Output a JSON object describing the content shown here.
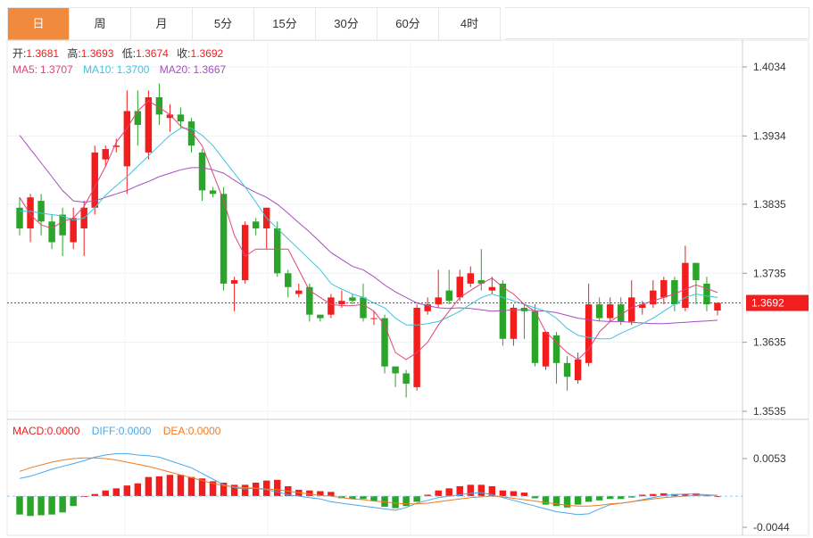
{
  "tabs": [
    {
      "label": "日",
      "active": true
    },
    {
      "label": "周",
      "active": false
    },
    {
      "label": "月",
      "active": false
    },
    {
      "label": "5分",
      "active": false
    },
    {
      "label": "15分",
      "active": false
    },
    {
      "label": "30分",
      "active": false
    },
    {
      "label": "60分",
      "active": false
    },
    {
      "label": "4时",
      "active": false
    }
  ],
  "info": {
    "open_label": "开:",
    "open_value": "1.3681",
    "high_label": "高:",
    "high_value": "1.3693",
    "low_label": "低:",
    "low_value": "1.3674",
    "close_label": "收:",
    "close_value": "1.3692",
    "ma5_label": "MA5:",
    "ma5_value": "1.3707",
    "ma10_label": "MA10:",
    "ma10_value": "1.3700",
    "ma20_label": "MA20:",
    "ma20_value": "1.3667"
  },
  "macd_info": {
    "macd_label": "MACD:",
    "macd_value": "0.0000",
    "diff_label": "DIFF:",
    "diff_value": "0.0000",
    "dea_label": "DEA:",
    "dea_value": "0.0000"
  },
  "current_price": "1.3692",
  "colors": {
    "up": "#f21d1d",
    "down": "#2aa52a",
    "ma5": "#e0457b",
    "ma10": "#3fc3e0",
    "ma20": "#a64dc0",
    "diff": "#4aa8e8",
    "dea": "#f07b23",
    "price_tag": "#f21d1d"
  },
  "chart_data": [
    {
      "type": "candlestick",
      "y_ticks": [
        "1.4034",
        "1.3934",
        "1.3835",
        "1.3735",
        "1.3635",
        "1.3535"
      ],
      "ylim": [
        1.3525,
        1.4045
      ],
      "candles": [
        [
          1.383,
          1.38,
          1.3845,
          1.379
        ],
        [
          1.38,
          1.3845,
          1.385,
          1.378
        ],
        [
          1.384,
          1.381,
          1.385,
          1.379
        ],
        [
          1.381,
          1.378,
          1.382,
          1.377
        ],
        [
          1.382,
          1.379,
          1.383,
          1.376
        ],
        [
          1.378,
          1.3815,
          1.383,
          1.377
        ],
        [
          1.38,
          1.383,
          1.384,
          1.376
        ],
        [
          1.383,
          1.391,
          1.392,
          1.382
        ],
        [
          1.39,
          1.3915,
          1.392,
          1.389
        ],
        [
          1.3918,
          1.392,
          1.393,
          1.391
        ],
        [
          1.389,
          1.397,
          1.4,
          1.385
        ],
        [
          1.397,
          1.395,
          1.4,
          1.392
        ],
        [
          1.391,
          1.399,
          1.4,
          1.39
        ],
        [
          1.399,
          1.3965,
          1.401,
          1.395
        ],
        [
          1.396,
          1.3965,
          1.398,
          1.394
        ],
        [
          1.3965,
          1.3955,
          1.3975,
          1.3945
        ],
        [
          1.3955,
          1.392,
          1.396,
          1.391
        ],
        [
          1.391,
          1.3855,
          1.3915,
          1.384
        ],
        [
          1.3855,
          1.385,
          1.386,
          1.3845
        ],
        [
          1.385,
          1.372,
          1.386,
          1.371
        ],
        [
          1.372,
          1.3725,
          1.373,
          1.368
        ],
        [
          1.3725,
          1.3805,
          1.381,
          1.372
        ],
        [
          1.381,
          1.38,
          1.3815,
          1.379
        ],
        [
          1.38,
          1.383,
          1.383,
          1.377
        ],
        [
          1.38,
          1.3735,
          1.381,
          1.373
        ],
        [
          1.3735,
          1.3715,
          1.374,
          1.37
        ],
        [
          1.3705,
          1.371,
          1.372,
          1.37
        ],
        [
          1.3715,
          1.3675,
          1.372,
          1.3665
        ],
        [
          1.3675,
          1.367,
          1.3675,
          1.3665
        ],
        [
          1.3675,
          1.37,
          1.3705,
          1.367
        ],
        [
          1.369,
          1.3695,
          1.371,
          1.3685
        ],
        [
          1.37,
          1.3695,
          1.3705,
          1.369
        ],
        [
          1.37,
          1.367,
          1.372,
          1.3665
        ],
        [
          1.367,
          1.367,
          1.368,
          1.366
        ],
        [
          1.367,
          1.36,
          1.3675,
          1.359
        ],
        [
          1.36,
          1.359,
          1.36,
          1.357
        ],
        [
          1.359,
          1.3575,
          1.3595,
          1.3555
        ],
        [
          1.357,
          1.3685,
          1.369,
          1.3565
        ],
        [
          1.368,
          1.369,
          1.37,
          1.3675
        ],
        [
          1.369,
          1.37,
          1.374,
          1.3685
        ],
        [
          1.371,
          1.3695,
          1.374,
          1.369
        ],
        [
          1.37,
          1.373,
          1.374,
          1.3695
        ],
        [
          1.372,
          1.3735,
          1.3745,
          1.3715
        ],
        [
          1.3725,
          1.372,
          1.377,
          1.371
        ],
        [
          1.371,
          1.3715,
          1.373,
          1.3705
        ],
        [
          1.372,
          1.364,
          1.3725,
          1.363
        ],
        [
          1.364,
          1.3685,
          1.369,
          1.363
        ],
        [
          1.3685,
          1.368,
          1.369,
          1.364
        ],
        [
          1.368,
          1.3605,
          1.369,
          1.36
        ],
        [
          1.36,
          1.365,
          1.365,
          1.3595
        ],
        [
          1.3645,
          1.3605,
          1.365,
          1.3575
        ],
        [
          1.3605,
          1.3585,
          1.3615,
          1.3565
        ],
        [
          1.358,
          1.361,
          1.362,
          1.3575
        ],
        [
          1.3605,
          1.369,
          1.372,
          1.36
        ],
        [
          1.369,
          1.367,
          1.37,
          1.3665
        ],
        [
          1.367,
          1.369,
          1.37,
          1.3665
        ],
        [
          1.369,
          1.3665,
          1.37,
          1.366
        ],
        [
          1.3665,
          1.37,
          1.3725,
          1.366
        ],
        [
          1.3685,
          1.369,
          1.3695,
          1.3675
        ],
        [
          1.369,
          1.371,
          1.3725,
          1.3685
        ],
        [
          1.37,
          1.3725,
          1.373,
          1.369
        ],
        [
          1.3725,
          1.369,
          1.373,
          1.368
        ],
        [
          1.3685,
          1.375,
          1.3775,
          1.368
        ],
        [
          1.375,
          1.3725,
          1.375,
          1.369
        ],
        [
          1.372,
          1.369,
          1.373,
          1.368
        ],
        [
          1.3681,
          1.3692,
          1.3693,
          1.3674
        ]
      ],
      "ma5": [
        1.3845,
        1.382,
        1.3805,
        1.38,
        1.381,
        1.3815,
        1.3832,
        1.386,
        1.389,
        1.3925,
        1.3945,
        1.397,
        1.3985,
        1.3975,
        1.3965,
        1.3948,
        1.394,
        1.392,
        1.388,
        1.384,
        1.379,
        1.376,
        1.377,
        1.377,
        1.377,
        1.377,
        1.374,
        1.371,
        1.37,
        1.369,
        1.3688,
        1.3688,
        1.369,
        1.368,
        1.366,
        1.362,
        1.361,
        1.362,
        1.3635,
        1.366,
        1.368,
        1.37,
        1.371,
        1.372,
        1.3728,
        1.3715,
        1.3705,
        1.369,
        1.368,
        1.365,
        1.3635,
        1.362,
        1.361,
        1.3625,
        1.365,
        1.3665,
        1.3675,
        1.3685,
        1.369,
        1.3695,
        1.37,
        1.3705,
        1.3712,
        1.3718,
        1.3713,
        1.3707
      ],
      "ma10": [
        1.3825,
        1.3825,
        1.3822,
        1.382,
        1.3818,
        1.3812,
        1.3815,
        1.383,
        1.3848,
        1.3862,
        1.3875,
        1.389,
        1.3905,
        1.392,
        1.3935,
        1.3945,
        1.3945,
        1.3935,
        1.392,
        1.39,
        1.388,
        1.386,
        1.3838,
        1.3815,
        1.38,
        1.3785,
        1.377,
        1.3755,
        1.374,
        1.372,
        1.3712,
        1.3705,
        1.37,
        1.3692,
        1.3685,
        1.367,
        1.366,
        1.366,
        1.3662,
        1.3665,
        1.3672,
        1.368,
        1.369,
        1.37,
        1.3705,
        1.37,
        1.3695,
        1.369,
        1.3685,
        1.368,
        1.367,
        1.3655,
        1.3645,
        1.3642,
        1.364,
        1.364,
        1.3648,
        1.3655,
        1.3662,
        1.367,
        1.368,
        1.369,
        1.37,
        1.3705,
        1.3702,
        1.37
      ],
      "ma20": [
        1.3935,
        1.3915,
        1.3895,
        1.3875,
        1.3855,
        1.384,
        1.3838,
        1.384,
        1.3845,
        1.385,
        1.3855,
        1.3862,
        1.3868,
        1.3875,
        1.388,
        1.3885,
        1.3888,
        1.3888,
        1.3885,
        1.388,
        1.387,
        1.386,
        1.3852,
        1.3845,
        1.3835,
        1.3822,
        1.3808,
        1.3795,
        1.378,
        1.3765,
        1.3755,
        1.3745,
        1.374,
        1.373,
        1.3718,
        1.3708,
        1.37,
        1.3692,
        1.3688,
        1.3685,
        1.3684,
        1.3685,
        1.3684,
        1.3682,
        1.368,
        1.3681,
        1.3682,
        1.3682,
        1.3681,
        1.368,
        1.3678,
        1.3674,
        1.367,
        1.3668,
        1.3666,
        1.3665,
        1.3665,
        1.3664,
        1.3663,
        1.3662,
        1.3662,
        1.3663,
        1.3664,
        1.3665,
        1.3666,
        1.3667
      ]
    },
    {
      "type": "bar",
      "y_ticks": [
        "0.0053",
        "-0.0044"
      ],
      "ylim": [
        -0.0051,
        0.007
      ],
      "macd": [
        -0.0026,
        -0.0028,
        -0.0027,
        -0.0026,
        -0.0023,
        -0.0014,
        0,
        0.0003,
        0.0008,
        0.0011,
        0.0015,
        0.0018,
        0.0027,
        0.0028,
        0.003,
        0.003,
        0.0027,
        0.0025,
        0.0021,
        0.0019,
        0.0016,
        0.0016,
        0.0019,
        0.0022,
        0.0023,
        0.0014,
        0.0009,
        0.0008,
        0.0007,
        0.0006,
        -0.0003,
        -0.0004,
        -0.0004,
        -0.0007,
        -0.0015,
        -0.0017,
        -0.0014,
        -0.0008,
        0.0002,
        0.0008,
        0.0011,
        0.0014,
        0.0016,
        0.0016,
        0.0014,
        0.0008,
        0.0007,
        0.0005,
        -0.0003,
        -0.0012,
        -0.0014,
        -0.0016,
        -0.0012,
        -0.0008,
        -0.0006,
        -0.0004,
        -0.0004,
        -0.0002,
        0.0002,
        0.0003,
        0.0004,
        0.0003,
        0.0003,
        0.0004,
        0.0001,
        0
      ],
      "diff": [
        0.0025,
        0.0028,
        0.0033,
        0.0038,
        0.0042,
        0.0046,
        0.005,
        0.0055,
        0.0058,
        0.006,
        0.006,
        0.0058,
        0.0057,
        0.0055,
        0.005,
        0.0045,
        0.004,
        0.0032,
        0.0024,
        0.0016,
        0.0012,
        0.001,
        0.0011,
        0.0009,
        0.0006,
        0.0002,
        0,
        -0.0002,
        -0.0004,
        -0.0008,
        -0.001,
        -0.0012,
        -0.0014,
        -0.0016,
        -0.0018,
        -0.002,
        -0.0016,
        -0.001,
        -0.0006,
        -0.0002,
        0,
        0.0002,
        0.0004,
        0.0005,
        0.0002,
        -0.0002,
        -0.0006,
        -0.001,
        -0.0014,
        -0.0018,
        -0.0022,
        -0.0024,
        -0.0026,
        -0.0025,
        -0.0018,
        -0.0012,
        -0.001,
        -0.0008,
        -0.0005,
        -0.0002,
        0.0001,
        0.0002,
        0.0003,
        0.0003,
        0.0002,
        0.0001
      ],
      "dea": [
        0.0035,
        0.004,
        0.0044,
        0.0048,
        0.0051,
        0.0053,
        0.0054,
        0.0054,
        0.0053,
        0.0051,
        0.0048,
        0.0045,
        0.0042,
        0.0038,
        0.0034,
        0.003,
        0.0026,
        0.0022,
        0.0018,
        0.0015,
        0.0013,
        0.0012,
        0.0011,
        0.001,
        0.0009,
        0.0007,
        0.0005,
        0.0003,
        0.0001,
        0,
        -0.0002,
        -0.0004,
        -0.0005,
        -0.0007,
        -0.0008,
        -0.001,
        -0.0011,
        -0.0011,
        -0.001,
        -0.0008,
        -0.0006,
        -0.0004,
        -0.0002,
        -0.0001,
        0,
        -0.0001,
        -0.0003,
        -0.0005,
        -0.0007,
        -0.0009,
        -0.0011,
        -0.0013,
        -0.0014,
        -0.0014,
        -0.0013,
        -0.0011,
        -0.001,
        -0.0008,
        -0.0006,
        -0.0004,
        -0.0002,
        -0.0001,
        0,
        0.0001,
        0.0001,
        0.0001
      ]
    }
  ]
}
